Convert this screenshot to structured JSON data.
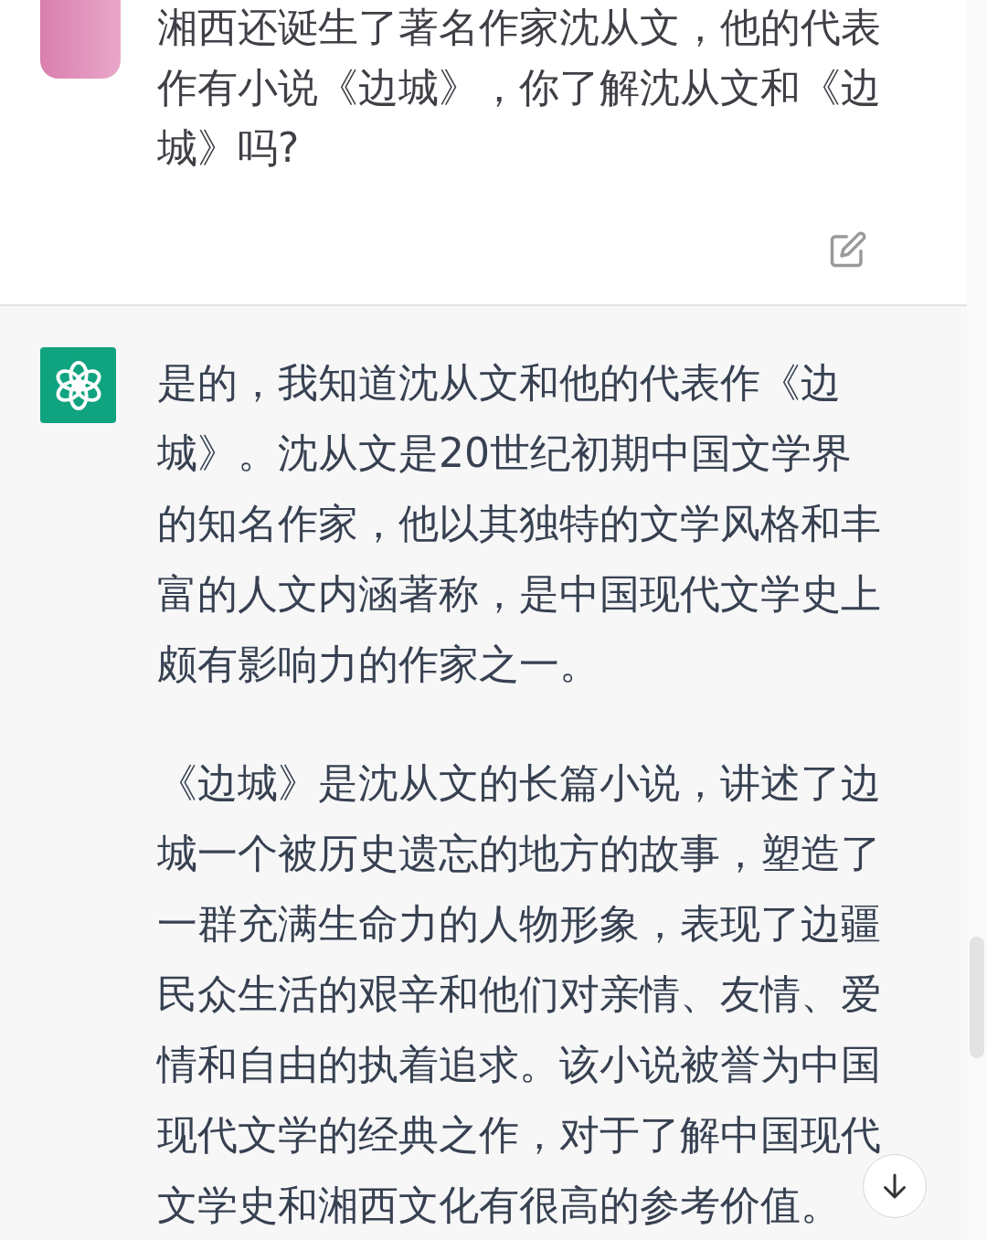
{
  "user_message": {
    "text": "湘西还诞生了著名作家沈从文，他的代表作有小说《边城》，你了解沈从文和《边城》吗?"
  },
  "assistant_message": {
    "paragraphs": [
      "是的，我知道沈从文和他的代表作《边城》。沈从文是20世纪初期中国文学界的知名作家，他以其独特的文学风格和丰富的人文内涵著称，是中国现代文学史上颇有影响力的作家之一。",
      "《边城》是沈从文的长篇小说，讲述了边城一个被历史遗忘的地方的故事，塑造了一群充满生命力的人物形象，表现了边疆民众生活的艰辛和他们对亲情、友情、爱情和自由的执着追求。该小说被誉为中国现代文学的经典之作，对于了解中国现代文学史和湘西文化有很高的参考价值。"
    ]
  }
}
